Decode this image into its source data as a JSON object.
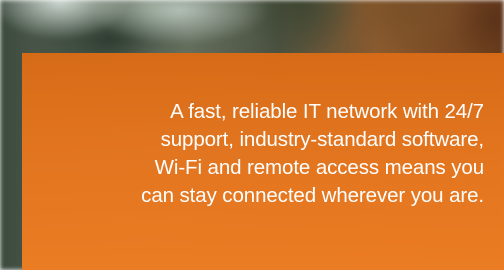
{
  "banner": {
    "lines": [
      "A fast, reliable IT network with 24/7",
      "support, industry-standard software,",
      "Wi-Fi and remote access means you",
      "can stay connected wherever you are."
    ],
    "overlay_color": "#e6761e",
    "text_color": "#ffffff"
  }
}
